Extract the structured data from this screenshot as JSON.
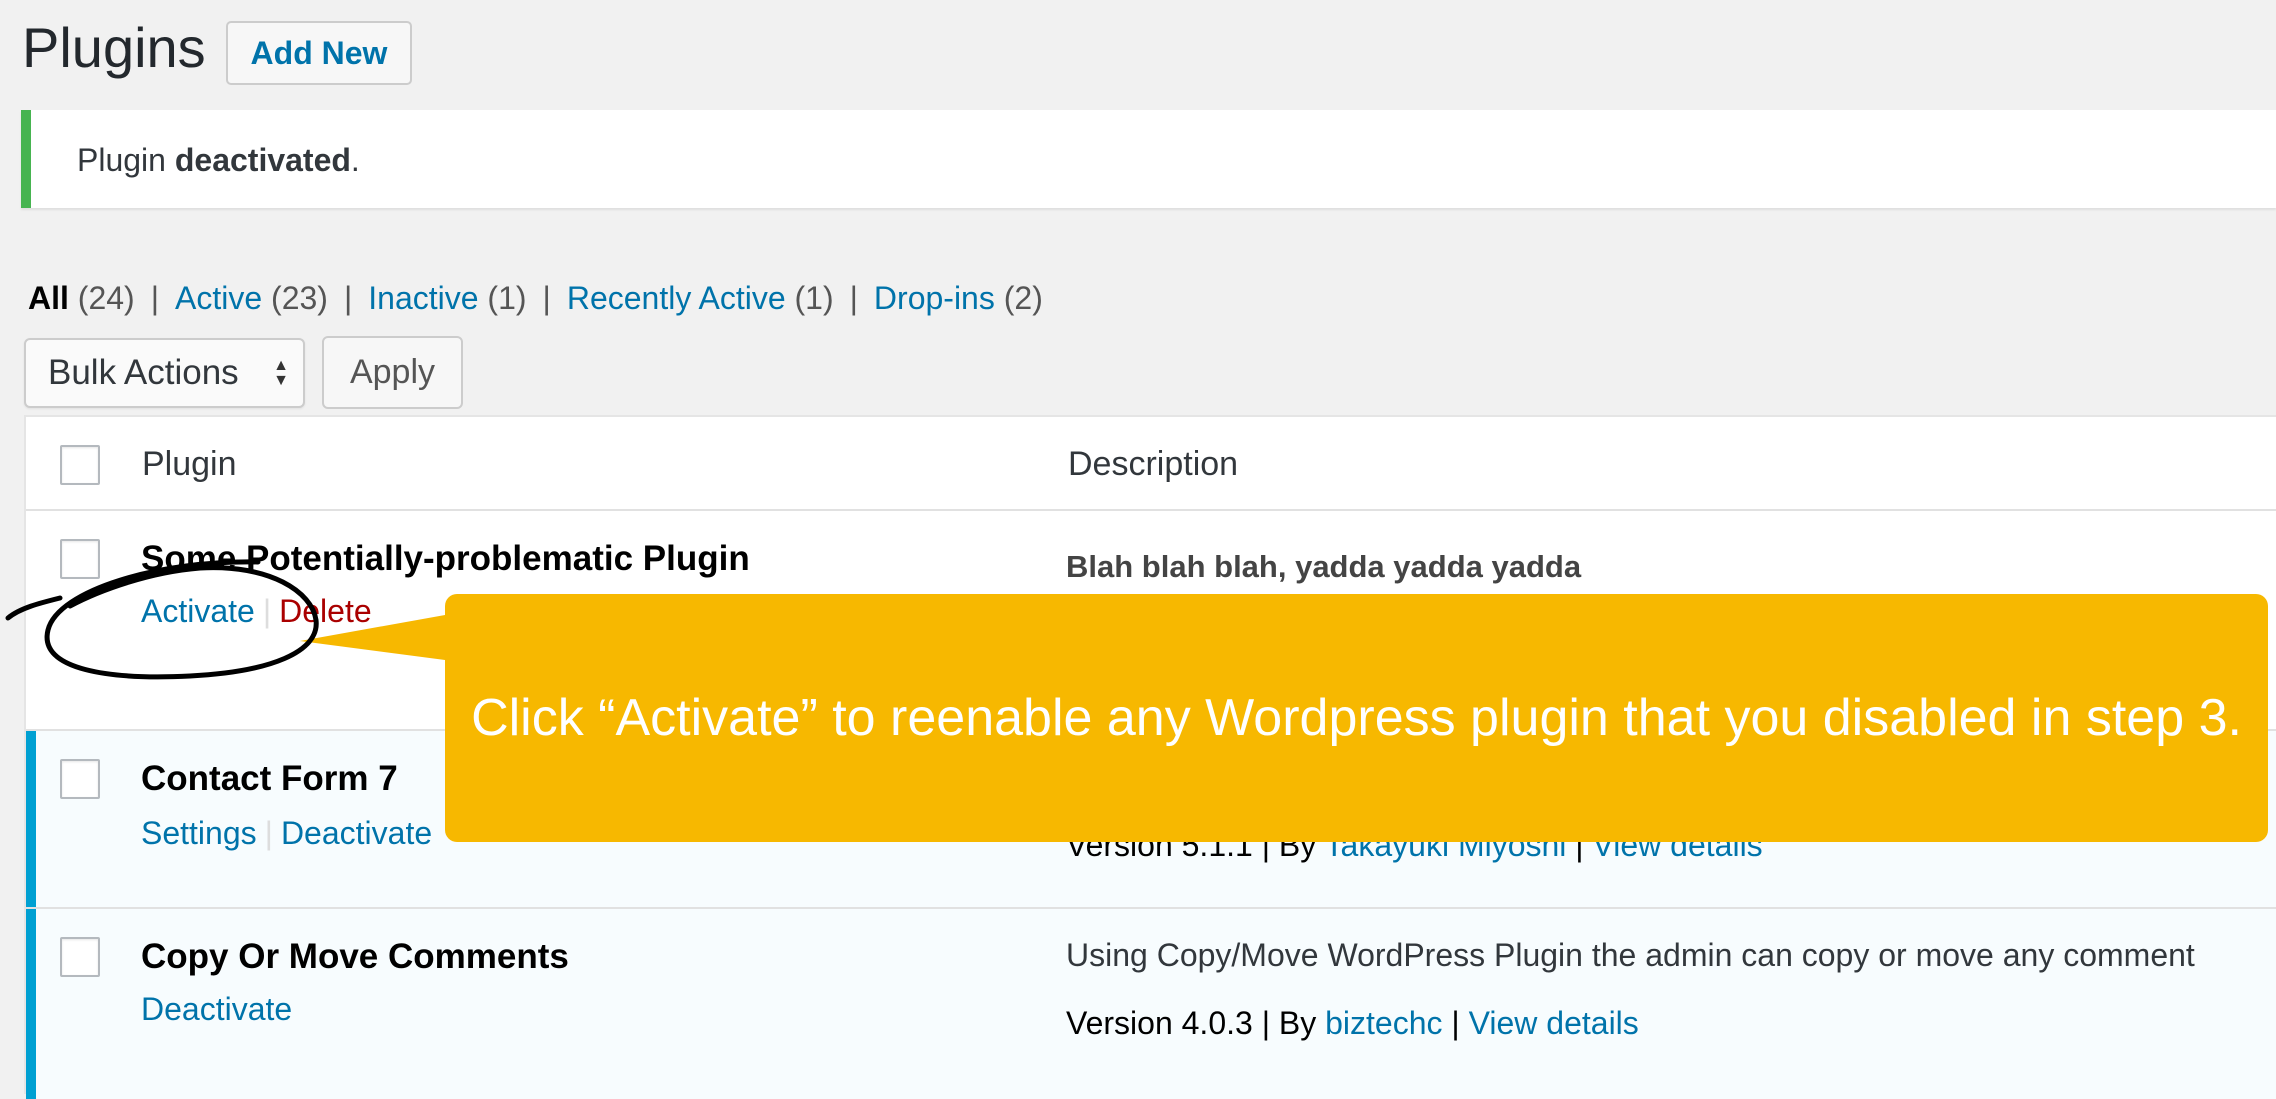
{
  "header": {
    "title": "Plugins",
    "add_new_label": "Add New"
  },
  "notice": {
    "prefix": "Plugin ",
    "bold": "deactivated",
    "suffix": "."
  },
  "views": [
    {
      "label": "All",
      "count": "(24)",
      "current": true
    },
    {
      "label": "Active",
      "count": "(23)",
      "current": false
    },
    {
      "label": "Inactive",
      "count": "(1)",
      "current": false
    },
    {
      "label": "Recently Active",
      "count": "(1)",
      "current": false
    },
    {
      "label": "Drop-ins",
      "count": "(2)",
      "current": false
    }
  ],
  "bulk_actions": {
    "selected": "Bulk Actions",
    "apply_label": "Apply"
  },
  "table": {
    "col_plugin": "Plugin",
    "col_description": "Description",
    "rows": [
      {
        "name": "Some Potentially-problematic Plugin",
        "actions": [
          "Activate",
          "Delete"
        ],
        "description": "Blah blah blah, yadda yadda yadda",
        "state": "inactive"
      },
      {
        "name": "Contact Form 7",
        "actions": [
          "Settings",
          "Deactivate"
        ],
        "version": "Version 5.1.1",
        "by": "By",
        "author": "Takayuki Miyoshi",
        "view_details": "View details",
        "state": "active"
      },
      {
        "name": "Copy Or Move Comments",
        "actions": [
          "Deactivate"
        ],
        "description": "Using Copy/Move WordPress Plugin the admin can copy or move any comment",
        "version": "Version 4.0.3",
        "by": "By",
        "author": "biztechc",
        "view_details": "View details",
        "state": "active"
      }
    ]
  },
  "callout": {
    "text": "Click “Activate” to reenable any Wordpress plugin that you disabled in step 3.",
    "color": "#f7b800"
  },
  "colors": {
    "link": "#0073aa",
    "delete": "#aa0000",
    "active_border": "#00a0d2",
    "notice_border": "#46b450"
  }
}
